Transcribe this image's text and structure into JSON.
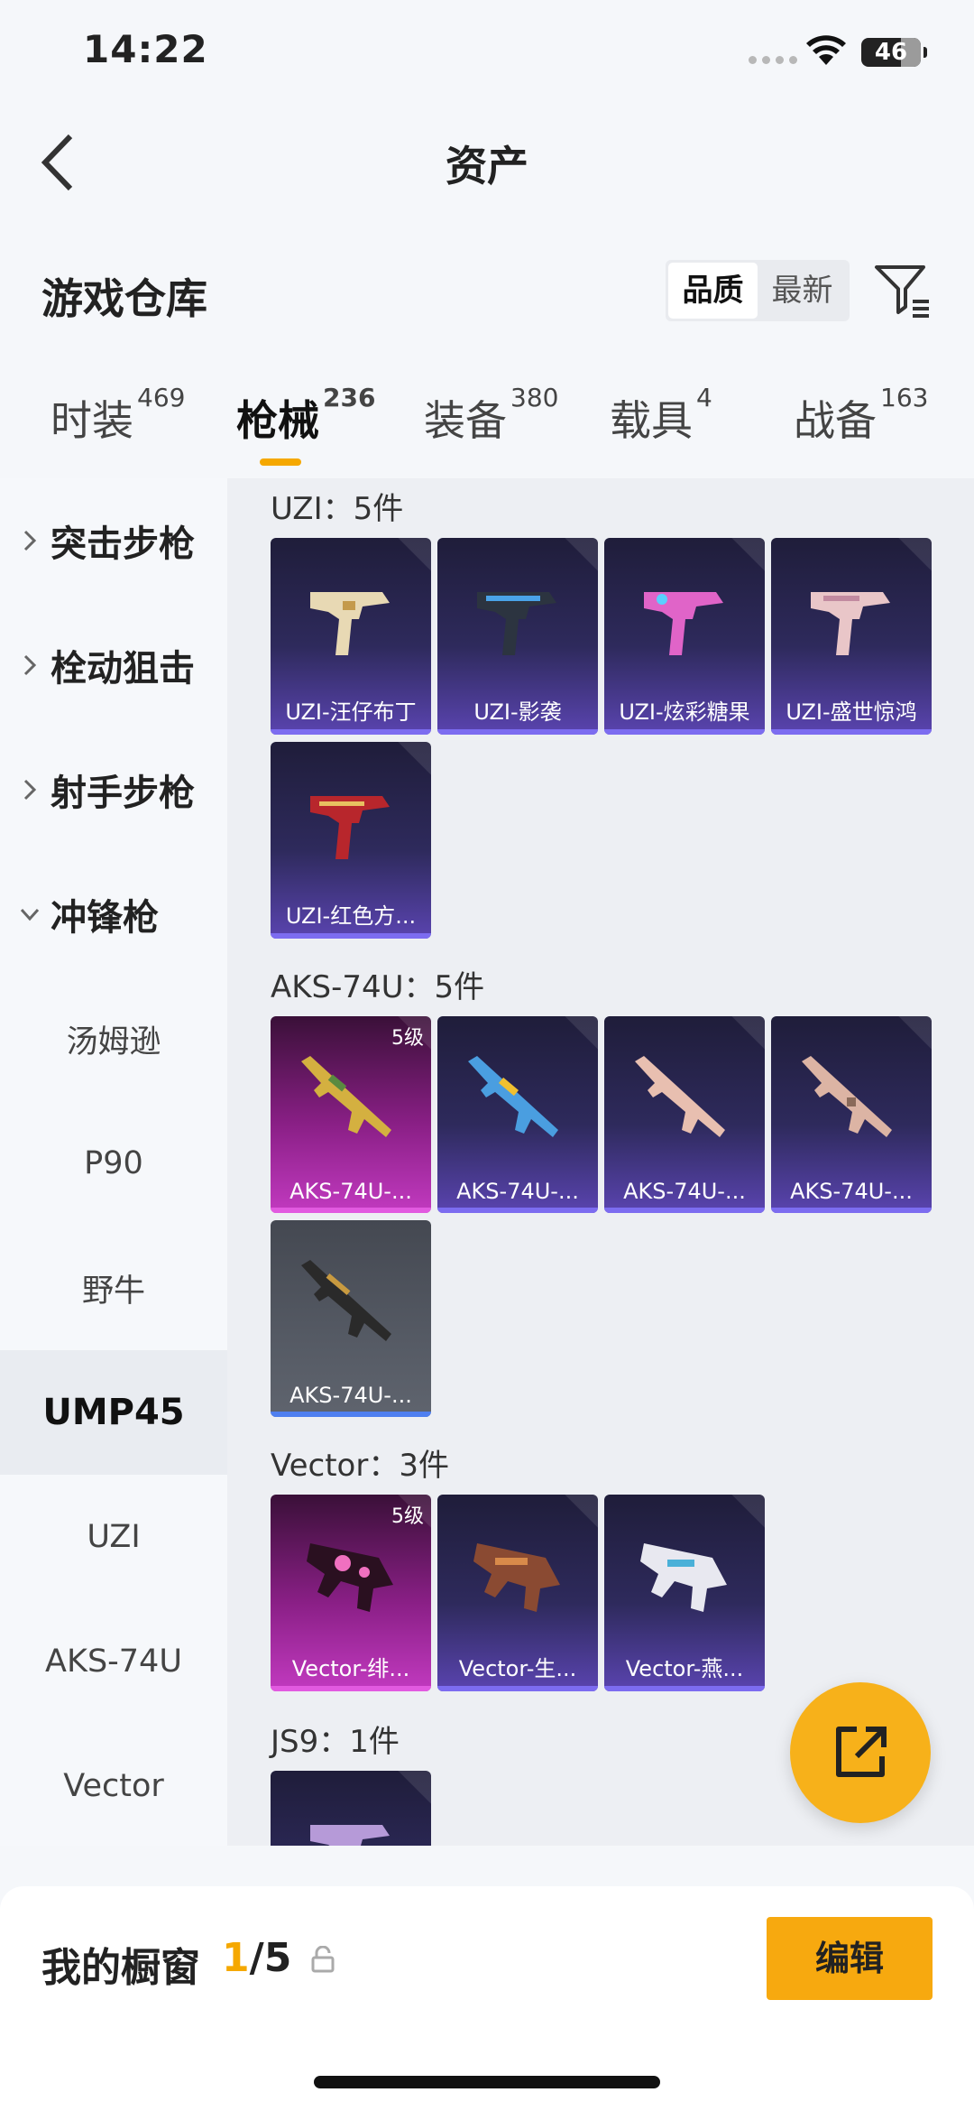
{
  "status_bar": {
    "time": "14:22",
    "battery": "46"
  },
  "nav": {
    "title": "资产"
  },
  "header": {
    "title": "游戏仓库",
    "sort_options": [
      "品质",
      "最新"
    ],
    "sort_active": "品质"
  },
  "tabs": [
    {
      "label": "时装",
      "count": "469"
    },
    {
      "label": "枪械",
      "count": "236"
    },
    {
      "label": "装备",
      "count": "380"
    },
    {
      "label": "载具",
      "count": "4"
    },
    {
      "label": "战备",
      "count": "163"
    }
  ],
  "sidebar": {
    "categories": [
      "突击步枪",
      "栓动狙击",
      "射手步枪",
      "冲锋枪"
    ],
    "subitems": [
      "汤姆逊",
      "P90",
      "野牛",
      "UMP45",
      "UZI",
      "AKS-74U",
      "Vector"
    ],
    "selected": "UMP45"
  },
  "groups": [
    {
      "title": "UZI：5件",
      "items": [
        {
          "label": "UZI-汪仔布丁",
          "style": "blue"
        },
        {
          "label": "UZI-影袭",
          "style": "blue"
        },
        {
          "label": "UZI-炫彩糖果",
          "style": "blue"
        },
        {
          "label": "UZI-盛世惊鸿",
          "style": "blue"
        },
        {
          "label": "UZI-红色方...",
          "style": "blue"
        }
      ]
    },
    {
      "title": "AKS-74U：5件",
      "items": [
        {
          "label": "AKS-74U-...",
          "style": "purple",
          "level": "5级"
        },
        {
          "label": "AKS-74U-...",
          "style": "blue"
        },
        {
          "label": "AKS-74U-...",
          "style": "blue"
        },
        {
          "label": "AKS-74U-...",
          "style": "blue"
        },
        {
          "label": "AKS-74U-...",
          "style": "gray"
        }
      ]
    },
    {
      "title": "Vector：3件",
      "items": [
        {
          "label": "Vector-绯...",
          "style": "purple",
          "level": "5级"
        },
        {
          "label": "Vector-生...",
          "style": "blue"
        },
        {
          "label": "Vector-燕...",
          "style": "blue"
        }
      ]
    },
    {
      "title": "JS9：1件",
      "items": [
        {
          "label": "",
          "style": "blue"
        }
      ]
    }
  ],
  "showcase": {
    "title": "我的橱窗",
    "current": "1",
    "total": "/5",
    "edit_label": "编辑"
  },
  "colors": {
    "accent": "#f5a800",
    "card_blue": "#2e2a5c",
    "card_purple": "#8a1f86",
    "card_gray": "#555a64"
  }
}
